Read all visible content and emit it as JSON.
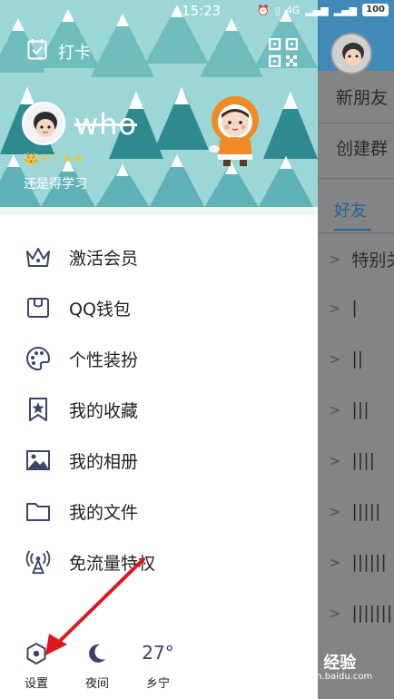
{
  "status_bar": {
    "time": "15:23",
    "network": "4G",
    "battery": "100"
  },
  "drawer": {
    "checkin_label": "打卡",
    "nickname": "who",
    "level_badges": "👑☀☾★★",
    "signature": "还是得学习",
    "menu": [
      {
        "icon": "crown-icon",
        "label": "激活会员"
      },
      {
        "icon": "wallet-icon",
        "label": "QQ钱包"
      },
      {
        "icon": "palette-icon",
        "label": "个性装扮"
      },
      {
        "icon": "bookmark-star-icon",
        "label": "我的收藏"
      },
      {
        "icon": "photo-icon",
        "label": "我的相册"
      },
      {
        "icon": "folder-icon",
        "label": "我的文件"
      },
      {
        "icon": "signal-tower-icon",
        "label": "免流量特权"
      }
    ],
    "bottom": {
      "settings_label": "设置",
      "night_label": "夜间",
      "temperature": "27°",
      "city": "乡宁"
    }
  },
  "back_panel": {
    "row1": "新朋友",
    "row2": "创建群",
    "tab_friends": "好友",
    "groups": [
      "特别关心",
      "|",
      "||",
      "|||",
      "||||",
      "|||||",
      "||||||",
      "|||||||"
    ]
  },
  "watermark": {
    "main": "Bai 经验",
    "sub": "jingyan.baidu.com"
  },
  "colors": {
    "hero_bg": "#9dd6d6",
    "back_header": "#3f8ab7",
    "accent_blue": "#2361a1",
    "icon_navy": "#3b4468",
    "annotation_red": "#e0181c"
  }
}
